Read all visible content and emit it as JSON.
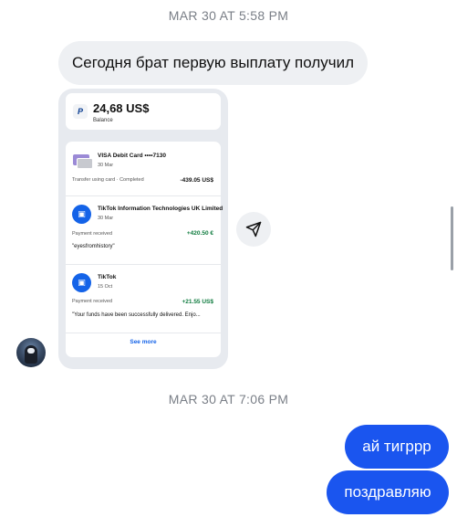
{
  "messages": {
    "timestamp_1": "MAR 30 AT 5:58 PM",
    "incoming_text": "Сегодня брат первую выплату получил",
    "timestamp_2": "MAR 30 AT 7:06 PM",
    "outgoing_1": "ай тигррр",
    "outgoing_2": "поздравляю"
  },
  "screenshot": {
    "balance_amount": "24,68 US$",
    "balance_label": "Balance",
    "transactions": [
      {
        "name": "VISA Debit Card ••••7130",
        "date": "30 Mar",
        "status": "Transfer using card · Completed",
        "amount": "-439.05 US$",
        "note": "",
        "icon": "card-icon"
      },
      {
        "name": "TikTok Information Technologies UK Limited",
        "date": "30 Mar",
        "status": "Payment received",
        "amount": "+420.50 €",
        "note": "\"eyesfromhistory\"",
        "icon": "store-icon"
      },
      {
        "name": "TikTok",
        "date": "15 Oct",
        "status": "Payment received",
        "amount": "+21.55 US$",
        "note": "\"Your funds have been successfully delivered. Enjo...",
        "icon": "store-icon"
      }
    ],
    "see_more": "See more"
  },
  "colors": {
    "outgoing_bubble": "#1a55ef",
    "incoming_bubble": "#eef0f3",
    "positive_amount": "#0d7a3d",
    "link": "#1463e8"
  },
  "icons": {
    "share": "share-icon",
    "paypal": "paypal-icon",
    "avatar": "avatar"
  }
}
